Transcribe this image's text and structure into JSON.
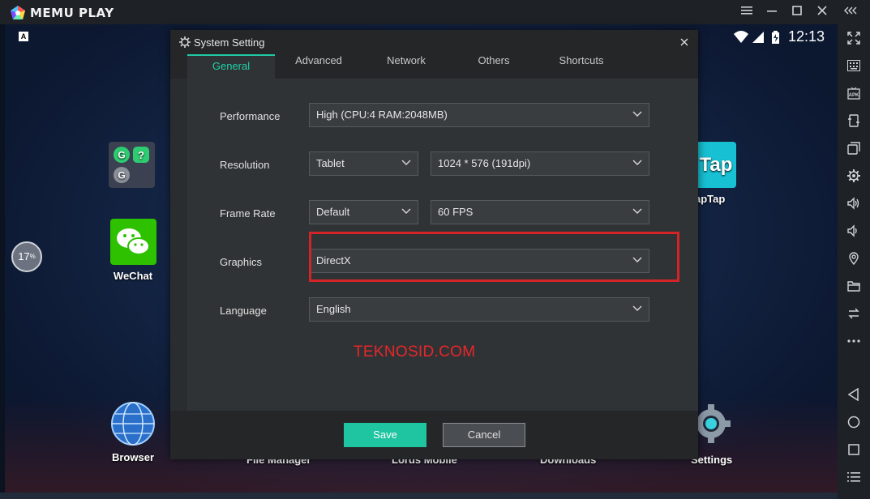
{
  "window": {
    "brand": "MEMU PLAY",
    "colors": {
      "accent": "#1fc9a3",
      "highlight": "#d42428",
      "titlebar": "#1e2226"
    }
  },
  "android": {
    "status_letter": "A",
    "time": "12:13",
    "battery_percent": "17",
    "percent_suffix": "%",
    "apps": {
      "wechat": "WeChat",
      "taptap": "apTap",
      "browser": "Browser",
      "file_manager": "File Manager",
      "lords_mobile": "Lords Mobile",
      "downloads": "Downloads",
      "settings": "Settings"
    }
  },
  "dialog": {
    "title": "System Setting",
    "tabs": [
      {
        "label": "General",
        "active": true
      },
      {
        "label": "Advanced",
        "active": false
      },
      {
        "label": "Network",
        "active": false
      },
      {
        "label": "Others",
        "active": false
      },
      {
        "label": "Shortcuts",
        "active": false
      }
    ],
    "fields": {
      "performance": {
        "label": "Performance",
        "value": "High (CPU:4 RAM:2048MB)"
      },
      "resolution": {
        "label": "Resolution",
        "mode": "Tablet",
        "value": "1024 * 576 (191dpi)"
      },
      "frame_rate": {
        "label": "Frame Rate",
        "mode": "Default",
        "value": "60 FPS"
      },
      "graphics": {
        "label": "Graphics",
        "value": "DirectX"
      },
      "language": {
        "label": "Language",
        "value": "English"
      }
    },
    "watermark": "TEKNOSID.COM",
    "save_label": "Save",
    "cancel_label": "Cancel"
  },
  "sidebar_icons": [
    "fullscreen-icon",
    "keyboard-icon",
    "apk-icon",
    "screenshot-icon",
    "multi-window-icon",
    "settings-icon",
    "volume-up-icon",
    "volume-down-icon",
    "location-icon",
    "folder-icon",
    "sync-icon",
    "more-icon",
    "back-icon",
    "home-icon",
    "recent-apps-icon",
    "menu-icon"
  ]
}
